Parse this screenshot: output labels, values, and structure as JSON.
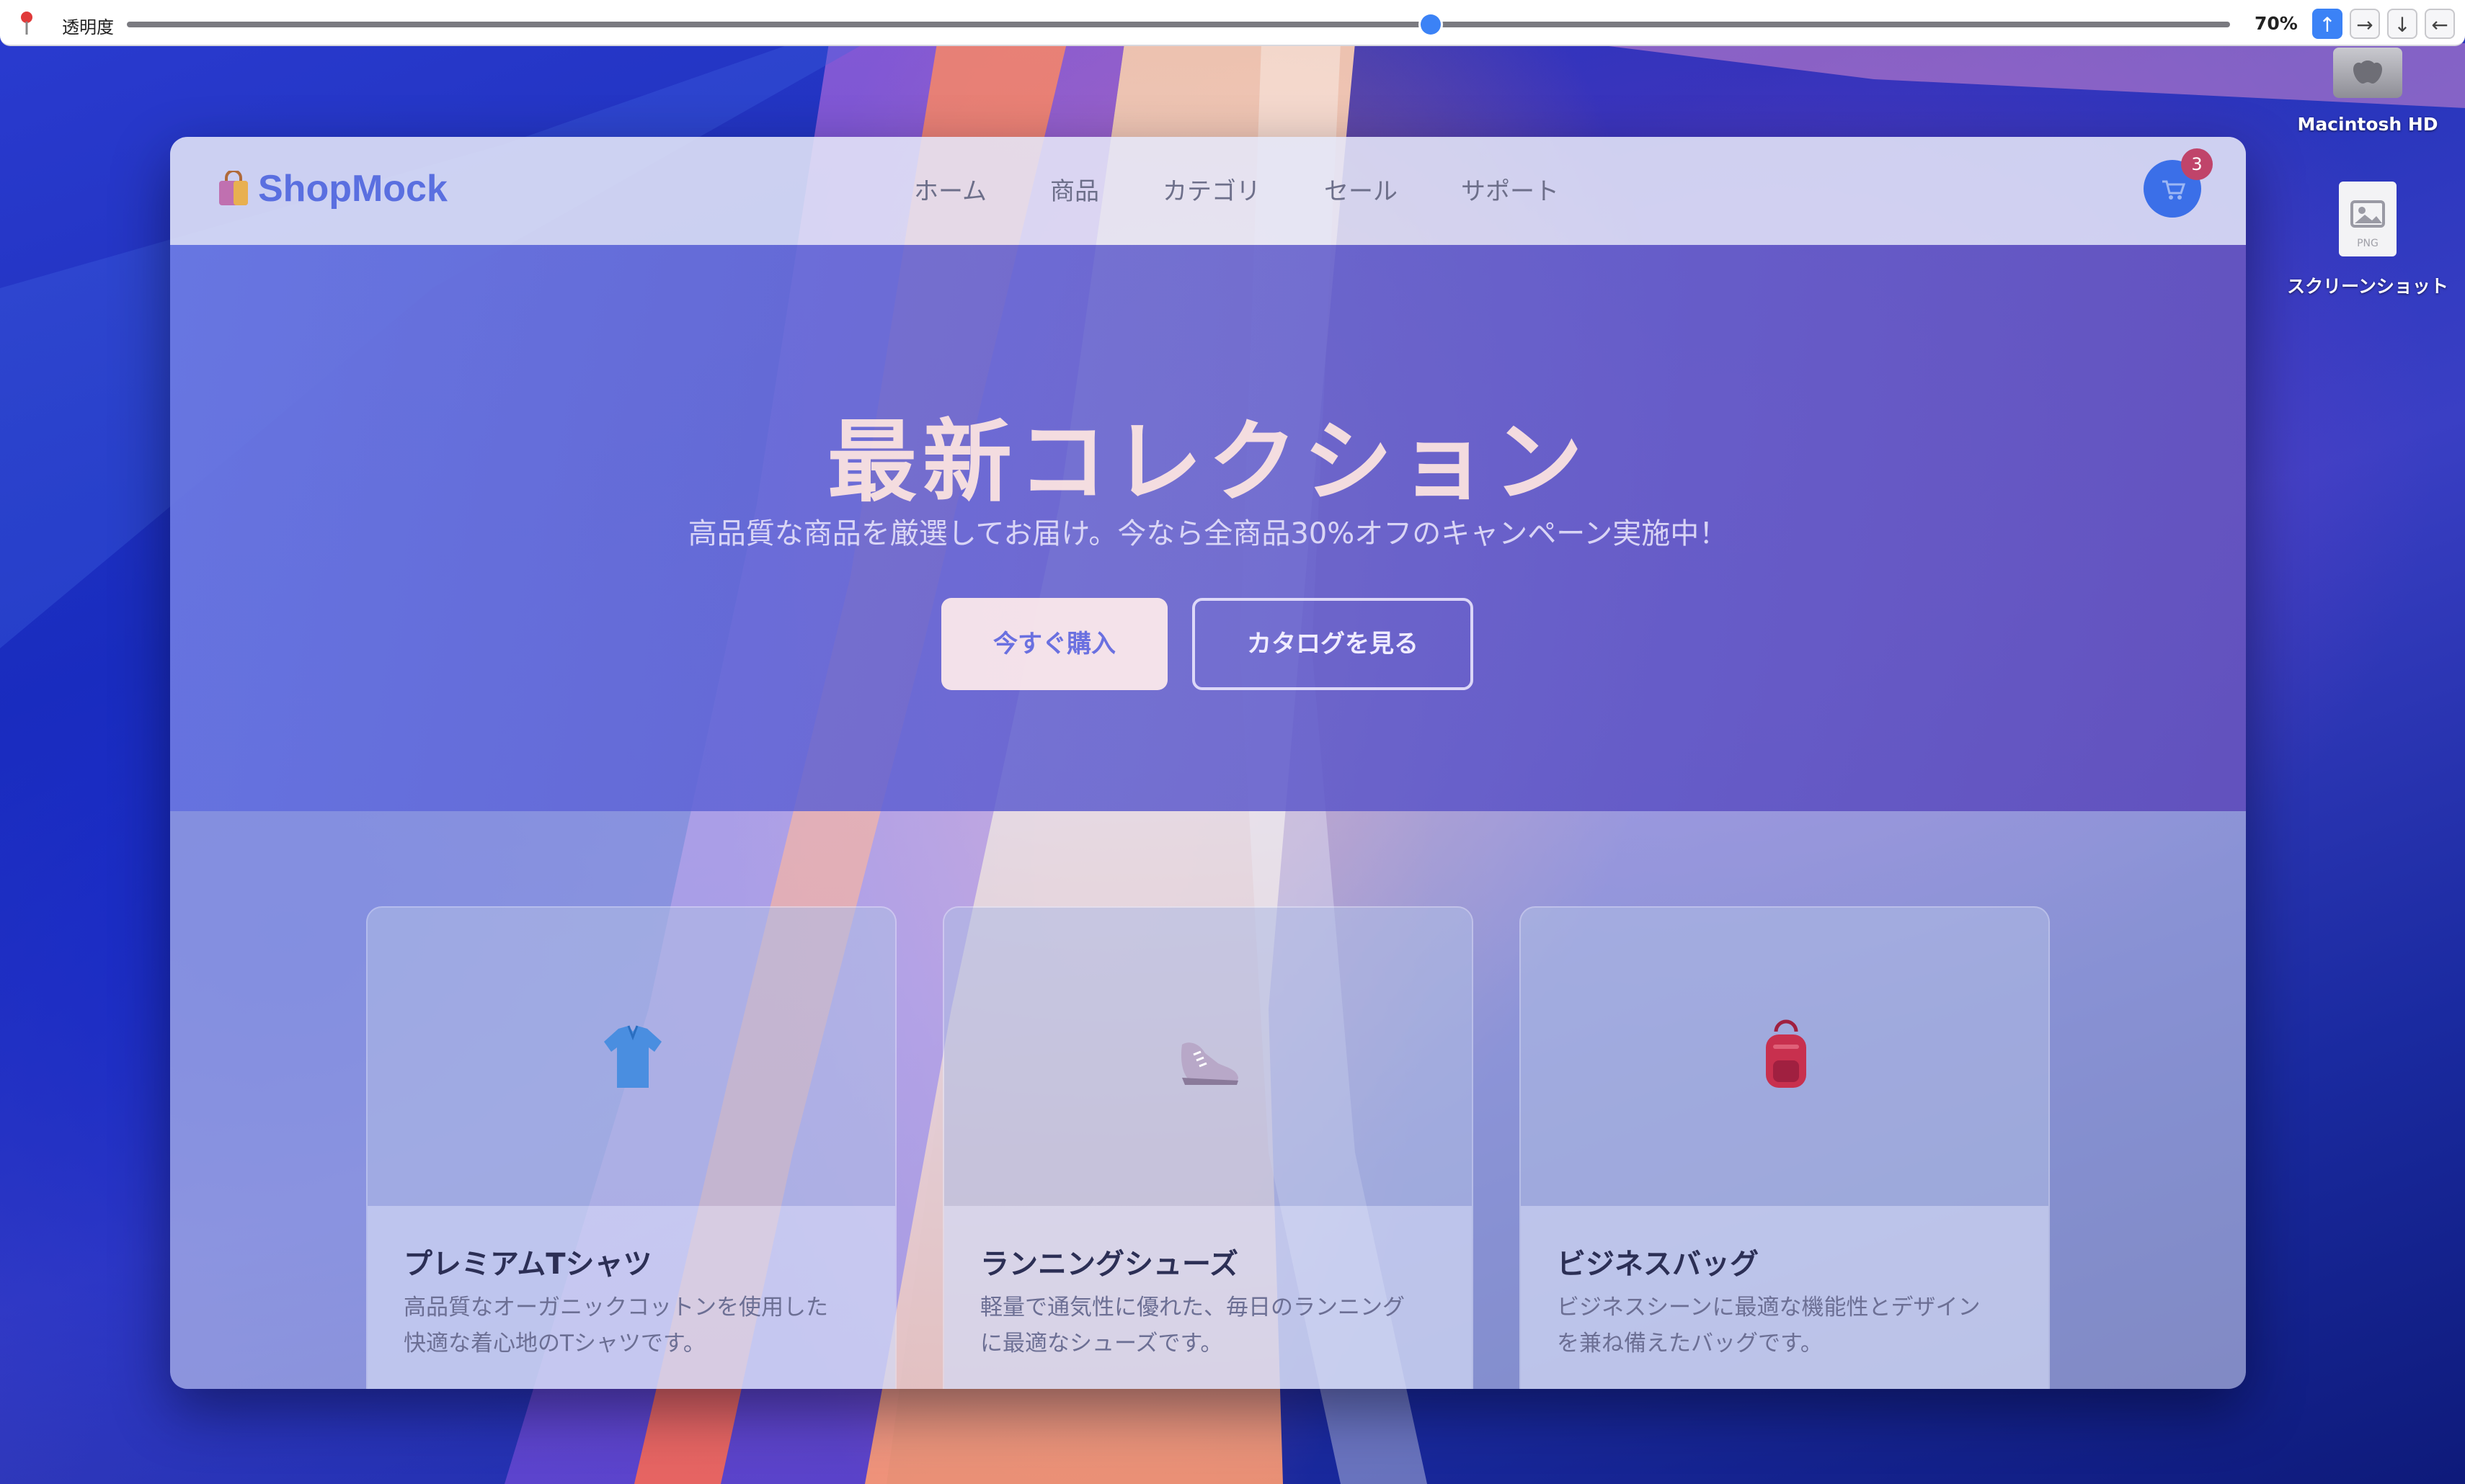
{
  "toolbar": {
    "opacity_label": "透明度",
    "opacity_value": "70%",
    "slider_fraction": 0.62,
    "arrows": [
      "↑",
      "→",
      "↓",
      "←"
    ],
    "active_arrow": 0
  },
  "desktop": {
    "icons": [
      {
        "label": "Macintosh HD"
      },
      {
        "label": "スクリーンショット",
        "badge": "PNG"
      }
    ]
  },
  "site": {
    "logo": "ShopMock",
    "nav": [
      "ホーム",
      "商品",
      "カテゴリ",
      "セール",
      "サポート"
    ],
    "cart_count": "3",
    "hero": {
      "title": "最新コレクション",
      "subtitle": "高品質な商品を厳選してお届け。今なら全商品30%オフのキャンペーン実施中！",
      "primary_button": "今すぐ購入",
      "secondary_button": "カタログを見る"
    },
    "products": [
      {
        "icon": "polo-shirt-icon",
        "title": "プレミアムTシャツ",
        "desc": [
          "高品質なオーガニックコットンを使用した",
          "快適な着心地のTシャツです。"
        ]
      },
      {
        "icon": "sneaker-icon",
        "title": "ランニングシューズ",
        "desc": [
          "軽量で通気性に優れた、毎日のランニング",
          "に最適なシューズです。"
        ]
      },
      {
        "icon": "backpack-icon",
        "title": "ビジネスバッグ",
        "desc": [
          "ビジネスシーンに最適な機能性とデザイン",
          "を兼ね備えたバッグです。"
        ]
      }
    ]
  },
  "colors": {
    "accent": "#3b82f6",
    "logo": "#5a6fe0",
    "badge": "#c0446a"
  }
}
